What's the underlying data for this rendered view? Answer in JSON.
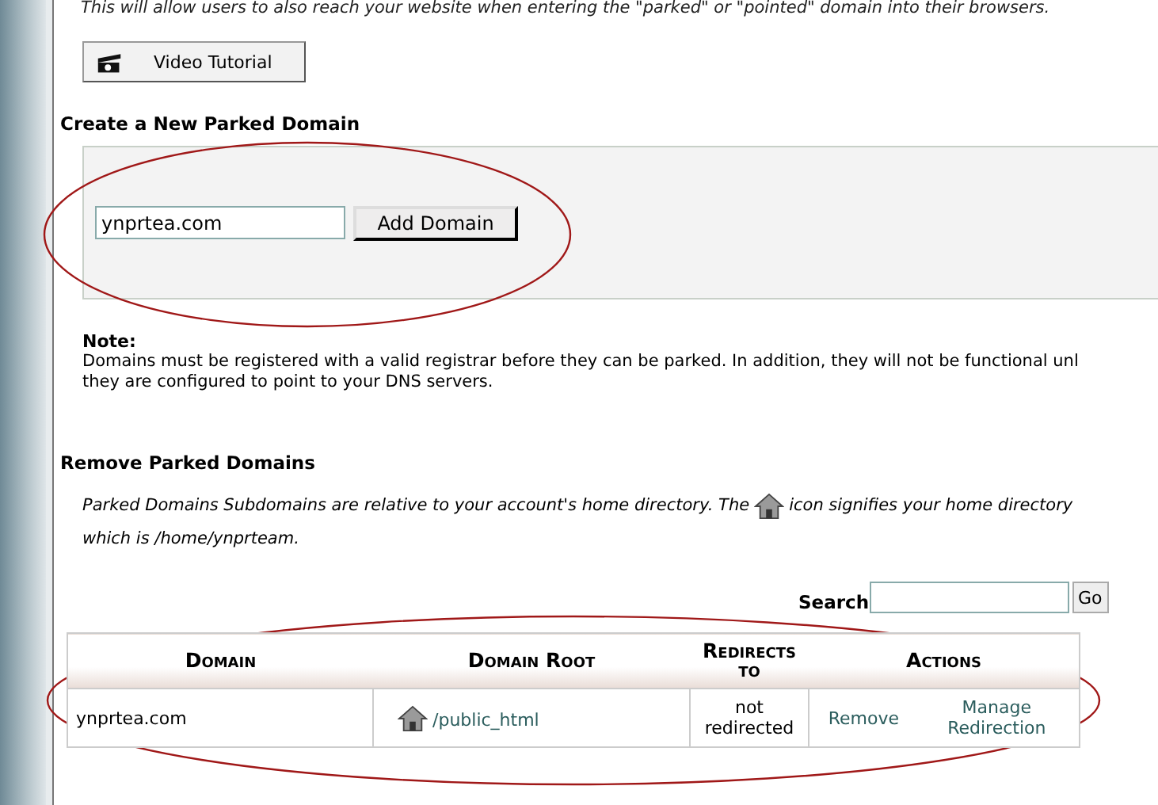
{
  "intro": "This will allow users to also reach your website when entering the \"parked\" or \"pointed\" domain into their browsers.",
  "tutorial_button": {
    "label": "Video Tutorial"
  },
  "create": {
    "title": "Create a New Parked Domain",
    "domain_field": {
      "value": "ynprtea.com"
    },
    "add_button": {
      "label": "Add Domain"
    }
  },
  "note": {
    "title": "Note:",
    "lines": [
      "Domains must be registered with a valid registrar before they can be parked. In addition, they will not be functional unl",
      "they are configured to point to your DNS servers."
    ]
  },
  "remove": {
    "title": "Remove Parked Domains",
    "description_before": "Parked Domains Subdomains are relative to your account's home directory. The",
    "description_after": "icon signifies your home directory",
    "description_line2": "which is /home/ynprteam."
  },
  "search": {
    "label": "Search",
    "button": "Go"
  },
  "table": {
    "columns": [
      "Domain",
      "Domain Root",
      "Redirects to",
      "Actions"
    ],
    "rows": [
      {
        "domain": "ynprtea.com",
        "root": "/public_html",
        "redirects": "not redirected",
        "actions": [
          "Remove",
          "Manage Redirection"
        ]
      }
    ]
  },
  "annotations": [
    {
      "kind": "ellipse"
    },
    {
      "kind": "ellipse"
    }
  ]
}
